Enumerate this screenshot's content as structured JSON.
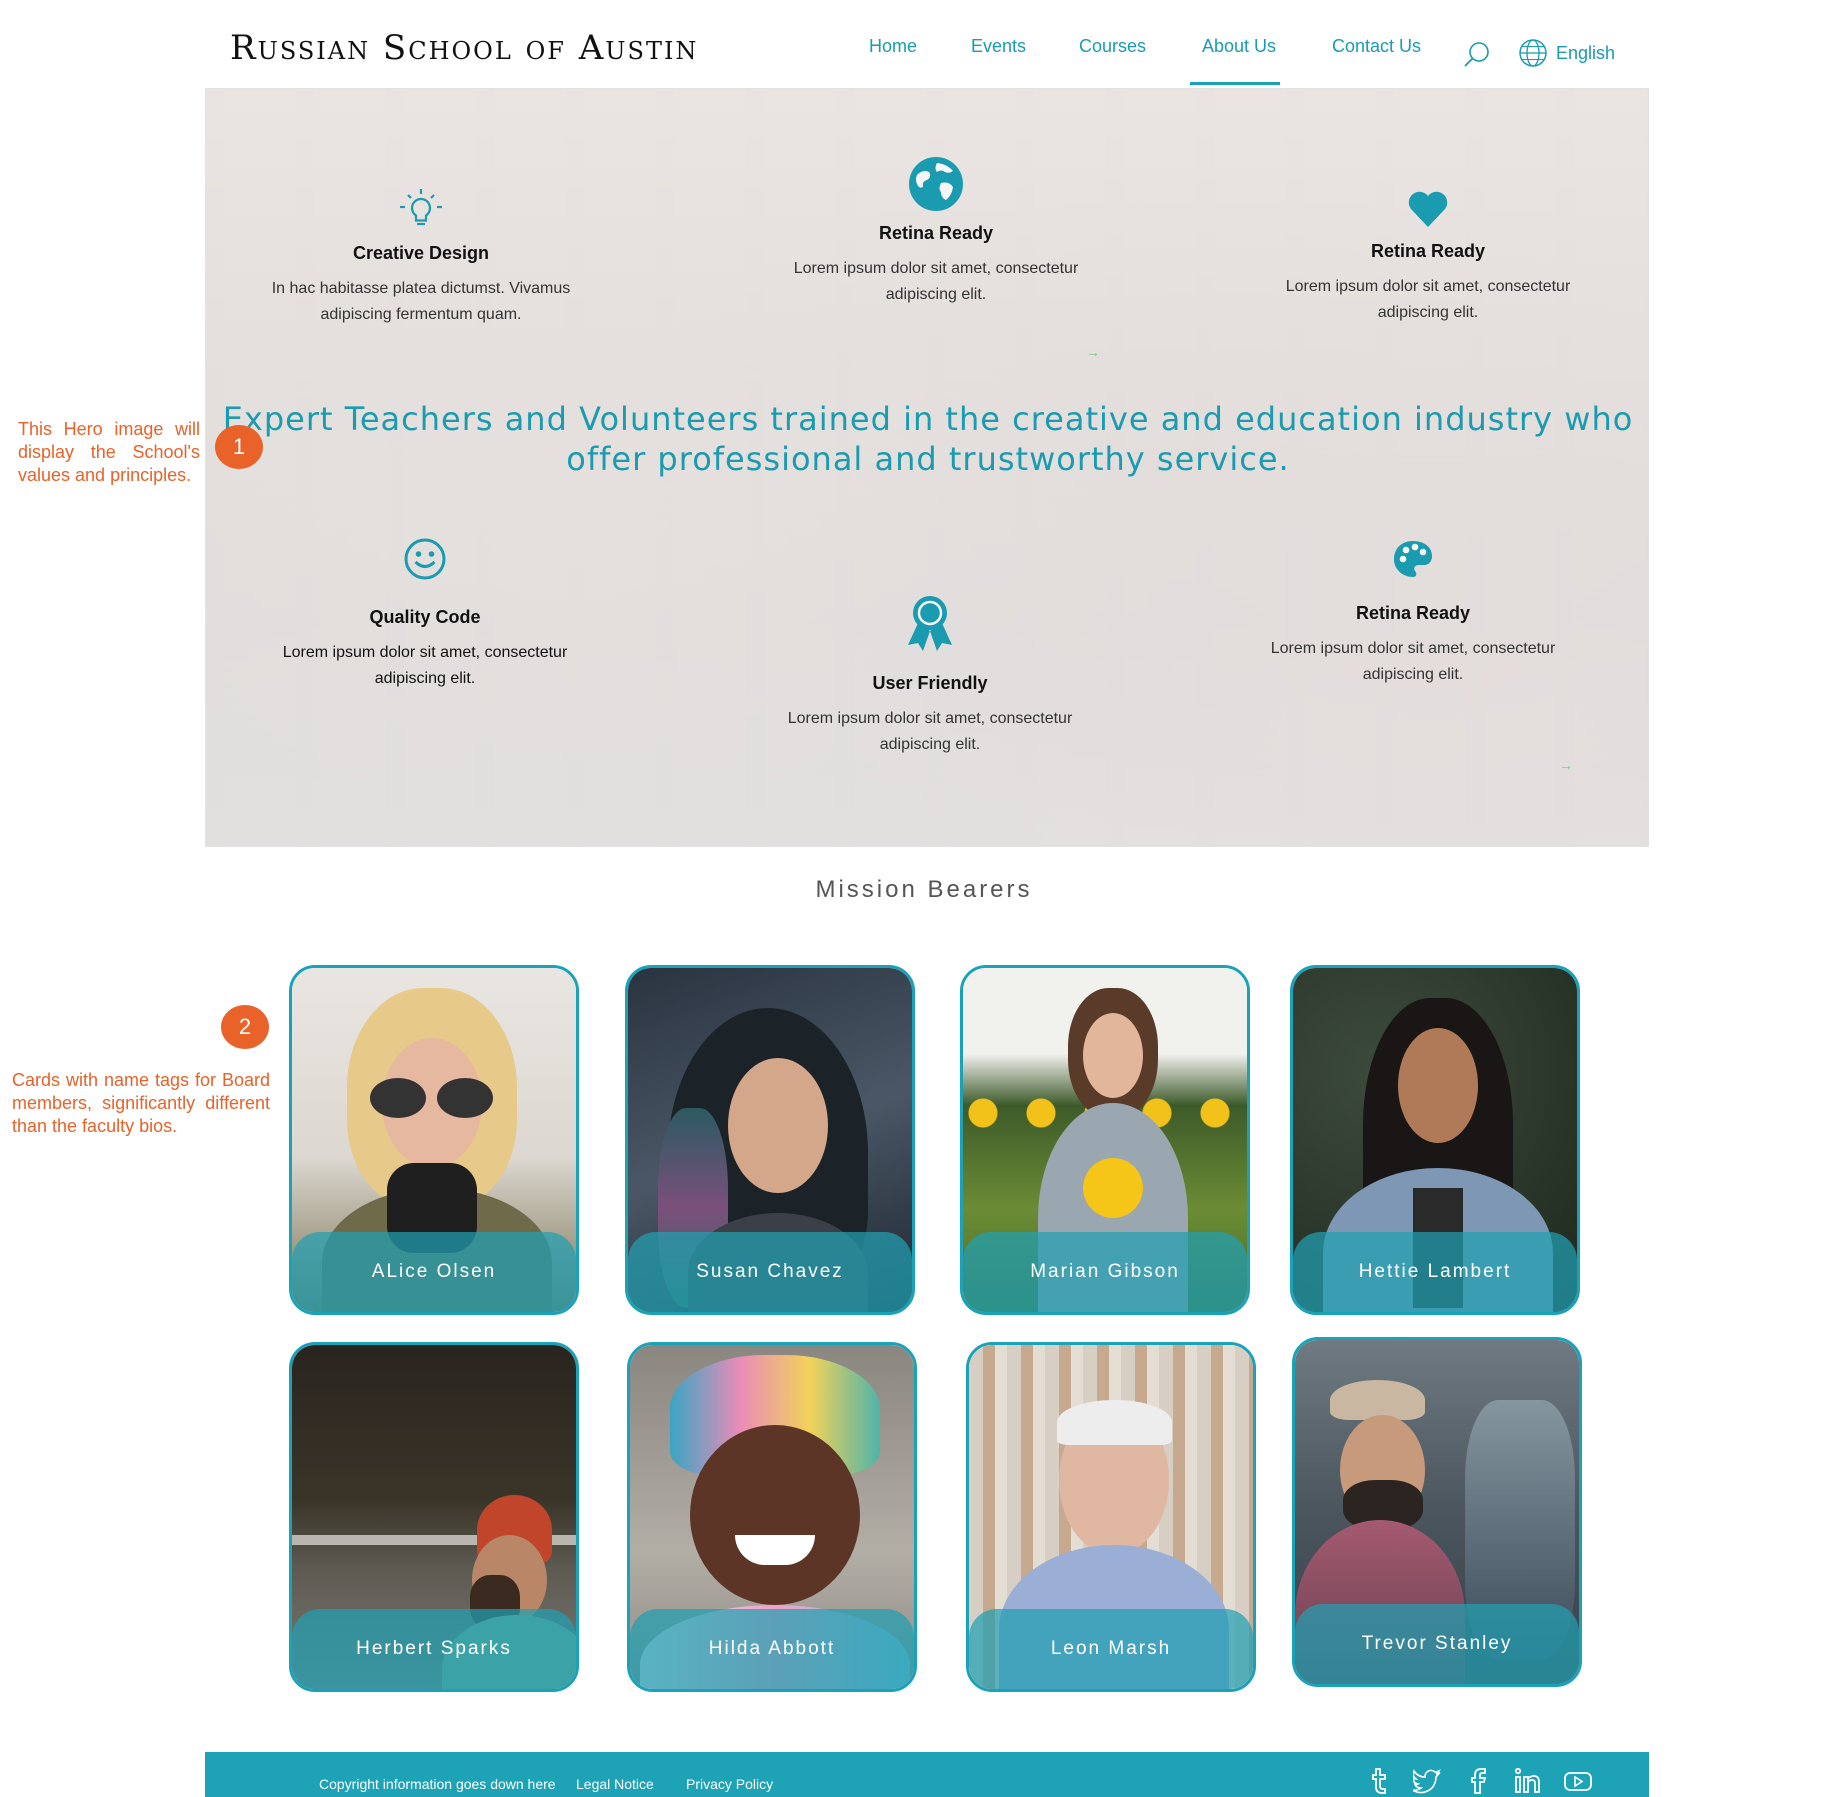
{
  "header": {
    "logo": "Russian School of Austin",
    "nav": [
      "Home",
      "Events",
      "Courses",
      "About Us",
      "Contact Us"
    ],
    "active_nav": "About Us",
    "language": "English"
  },
  "hero": {
    "features": [
      {
        "icon": "lightbulb-icon",
        "title": "Creative Design",
        "desc": "In hac habitasse platea dictumst. Vivamus adipiscing fermentum quam."
      },
      {
        "icon": "globe-icon",
        "title": "Retina Ready",
        "desc": "Lorem ipsum dolor sit amet, consectetur adipiscing elit."
      },
      {
        "icon": "heart-icon",
        "title": "Retina Ready",
        "desc": "Lorem ipsum dolor sit amet, consectetur adipiscing elit."
      },
      {
        "icon": "smiley-icon",
        "title": "Quality Code",
        "desc": "Lorem ipsum dolor sit amet, consectetur adipiscing elit."
      },
      {
        "icon": "ribbon-award-icon",
        "title": "User Friendly",
        "desc": "Lorem ipsum dolor sit amet, consectetur adipiscing elit."
      },
      {
        "icon": "palette-icon",
        "title": "Retina Ready",
        "desc": "Lorem ipsum dolor sit amet, consectetur adipiscing elit."
      }
    ],
    "tagline": "Expert Teachers and Volunteers trained in the creative and education industry who offer professional and trustworthy service.",
    "arrow": "→"
  },
  "annotations": [
    {
      "badge": "1",
      "text": "This Hero image will display the School's values and principles."
    },
    {
      "badge": "2",
      "text": "Cards with name tags for Board members, significantly different than the faculty bios."
    }
  ],
  "mission": {
    "title": "Mission Bearers",
    "members": [
      "ALice Olsen",
      "Susan Chavez",
      "Marian Gibson",
      "Hettie Lambert",
      "Herbert Sparks",
      "Hilda Abbott",
      "Leon Marsh",
      "Trevor Stanley"
    ]
  },
  "footer": {
    "copyright": "Copyright information goes down here",
    "legal": "Legal Notice",
    "privacy": "Privacy Policy",
    "social": [
      "tumblr-icon",
      "twitter-icon",
      "facebook-icon",
      "linkedin-icon",
      "youtube-icon"
    ]
  },
  "colors": {
    "accent": "#1aa3b8",
    "annotation": "#e8622a"
  }
}
